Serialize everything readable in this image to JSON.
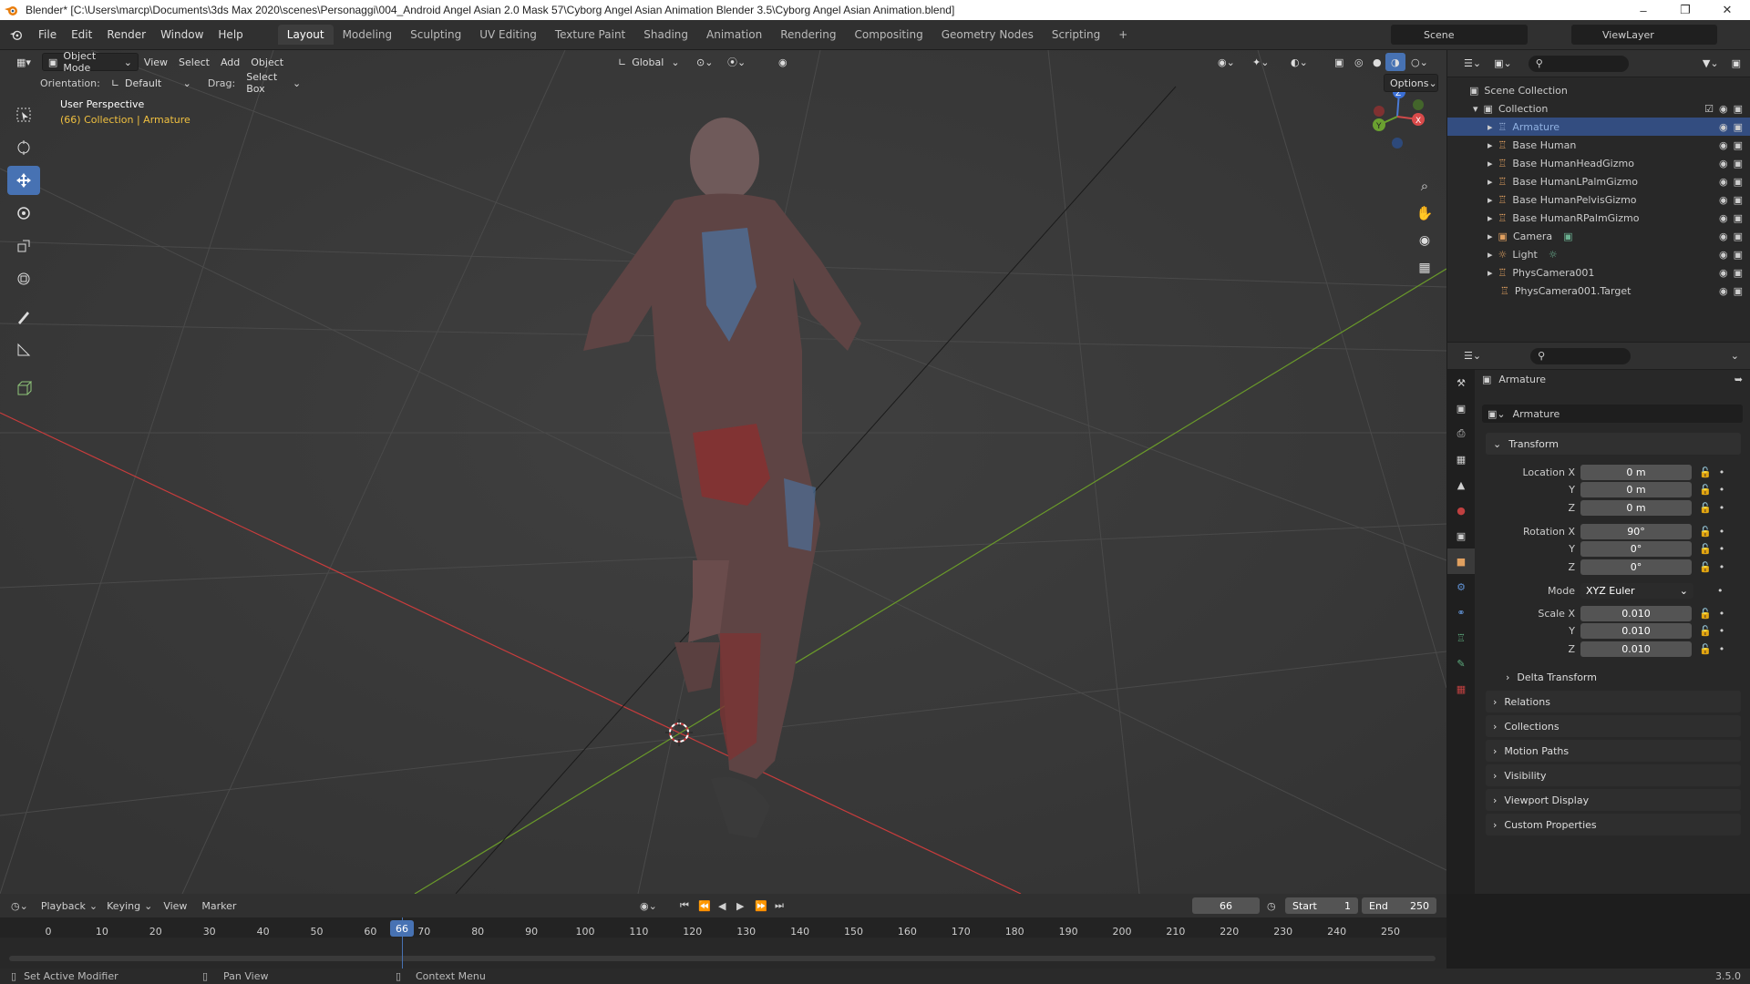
{
  "window": {
    "title": "Blender* [C:\\Users\\marcp\\Documents\\3ds Max 2020\\scenes\\Personaggi\\004_Android Angel Asian 2.0 Mask 57\\Cyborg Angel Asian Animation Blender 3.5\\Cyborg Angel Asian Animation.blend]"
  },
  "menu": {
    "items": [
      "File",
      "Edit",
      "Render",
      "Window",
      "Help"
    ],
    "workspaces": [
      "Layout",
      "Modeling",
      "Sculpting",
      "UV Editing",
      "Texture Paint",
      "Shading",
      "Animation",
      "Rendering",
      "Compositing",
      "Geometry Nodes",
      "Scripting"
    ],
    "add_tab": "+",
    "scene_label": "Scene",
    "viewlayer_label": "ViewLayer"
  },
  "viewport": {
    "mode": "Object Mode",
    "menus": [
      "View",
      "Select",
      "Add",
      "Object"
    ],
    "transform_orientation": "Global",
    "orientation_label": "Orientation:",
    "orientation_value": "Default",
    "drag_label": "Drag:",
    "drag_value": "Select Box",
    "options_label": "Options",
    "overlay_title": "User Perspective",
    "overlay_subtitle": "(66) Collection | Armature",
    "gizmo_axes": {
      "x": "X",
      "y": "Y",
      "z": "Z"
    }
  },
  "outliner": {
    "root": "Scene Collection",
    "collection": "Collection",
    "items": [
      {
        "name": "Armature",
        "selected": true
      },
      {
        "name": "Base Human",
        "selected": false
      },
      {
        "name": "Base HumanHeadGizmo",
        "selected": false
      },
      {
        "name": "Base HumanLPalmGizmo",
        "selected": false
      },
      {
        "name": "Base HumanPelvisGizmo",
        "selected": false
      },
      {
        "name": "Base HumanRPalmGizmo",
        "selected": false
      },
      {
        "name": "Camera",
        "selected": false
      },
      {
        "name": "Light",
        "selected": false
      },
      {
        "name": "PhysCamera001",
        "selected": false
      },
      {
        "name": "PhysCamera001.Target",
        "selected": false
      }
    ]
  },
  "properties": {
    "object_name": "Armature",
    "datablock_name": "Armature",
    "transform_header": "Transform",
    "location_label": "Location X",
    "location": [
      "0 m",
      "0 m",
      "0 m"
    ],
    "rotation_label": "Rotation X",
    "rotation": [
      "90°",
      "0°",
      "0°"
    ],
    "mode_label": "Mode",
    "mode_value": "XYZ Euler",
    "scale_label": "Scale X",
    "scale": [
      "0.010",
      "0.010",
      "0.010"
    ],
    "axis_y": "Y",
    "axis_z": "Z",
    "delta_transform": "Delta Transform",
    "panels": [
      "Relations",
      "Collections",
      "Motion Paths",
      "Visibility",
      "Viewport Display",
      "Custom Properties"
    ]
  },
  "timeline": {
    "menus": [
      "Playback",
      "Keying",
      "View",
      "Marker"
    ],
    "current_frame": "66",
    "start_label": "Start",
    "start": "1",
    "end_label": "End",
    "end": "250",
    "ticks": [
      "0",
      "10",
      "20",
      "30",
      "40",
      "50",
      "60",
      "70",
      "80",
      "90",
      "100",
      "110",
      "120",
      "130",
      "140",
      "150",
      "160",
      "170",
      "180",
      "190",
      "200",
      "210",
      "220",
      "230",
      "240",
      "250"
    ]
  },
  "status": {
    "left": "Set Active Modifier",
    "middle": "Pan View",
    "right": "Context Menu",
    "version": "3.5.0"
  },
  "colors": {
    "accent": "#4772b3",
    "selected_row": "#334d80",
    "x_axis": "#c83c3c",
    "y_axis": "#6a9a2a",
    "overlay_yellow": "#f0c040"
  }
}
